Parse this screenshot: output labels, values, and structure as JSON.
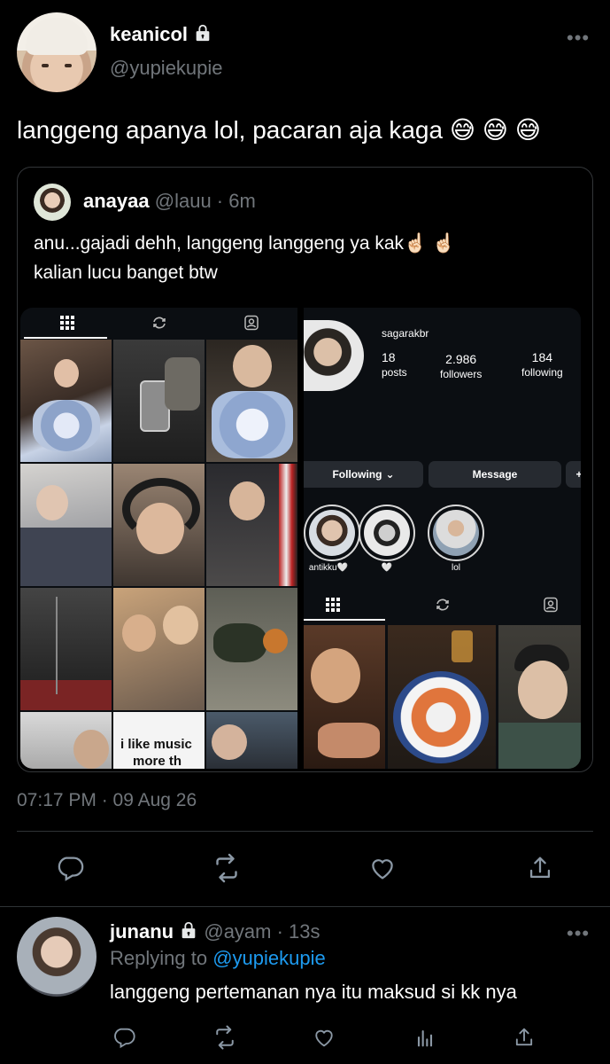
{
  "tweet": {
    "display_name": "keanicol",
    "handle": "@yupiekupie",
    "text": "langgeng apanya lol, pacaran aja kaga 😅 😅 😅",
    "timestamp": "07:17 PM · 09 Aug 26"
  },
  "quoted": {
    "display_name": "anayaa",
    "handle_time": "@lauu · 6m",
    "text_line1": "anu...gajadi dehh, langgeng langgeng ya kak☝🏻 ☝🏻",
    "text_line2": "kalian lucu banget btw",
    "grid_caption": "i like music",
    "grid_caption2": "more th",
    "profile": {
      "username": "sagarakbr",
      "posts_n": "18",
      "posts_l": "posts",
      "followers_n": "2.986",
      "followers_l": "followers",
      "following_n": "184",
      "following_l": "following",
      "following_btn": "Following",
      "message_btn": "Message",
      "highlights": [
        "antikku🤍",
        "🤍",
        "lol"
      ]
    }
  },
  "reply": {
    "display_name": "junanu",
    "handle_time": "@ayam · 13s",
    "replying_prefix": "Replying to",
    "replying_handle": "@yupiekupie",
    "text": "langgeng pertemanan nya itu maksud si kk nya"
  },
  "colors": {
    "background": "#000000",
    "text": "#e7e9ea",
    "muted": "#71767b",
    "link": "#1d9bf0",
    "divider": "#2f3336"
  }
}
